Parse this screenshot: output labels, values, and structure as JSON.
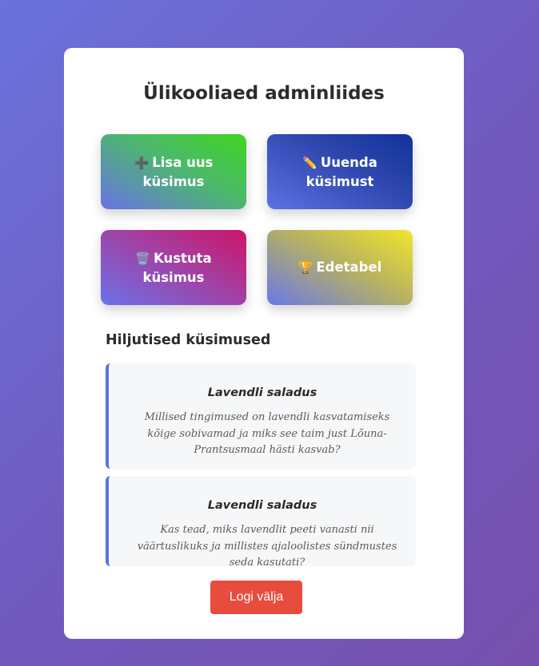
{
  "page": {
    "title": "Ülikooliaed adminliides"
  },
  "actions": {
    "add": {
      "icon": "➕",
      "icon_name": "plus-icon",
      "label": "Lisa uus küsimus"
    },
    "update": {
      "icon": "✏️",
      "icon_name": "pencil-icon",
      "label": "Uuenda küsimust"
    },
    "delete": {
      "icon": "🗑️",
      "icon_name": "wastebasket-icon",
      "label": "Kustuta küsimus"
    },
    "leaderboard": {
      "icon": "🏆",
      "icon_name": "trophy-icon",
      "label": "Edetabel"
    }
  },
  "recent": {
    "heading": "Hiljutised küsimused",
    "items": [
      {
        "title": "Lavendli saladus",
        "text": "Millised tingimused on lavendli kasvatamiseks kõige sobivamad ja miks see taim just Lõuna-Prantsusmaal hästi kasvab?"
      },
      {
        "title": "Lavendli saladus",
        "text": "Kas tead, miks lavendlit peeti vanasti nii väärtuslikuks ja millistes ajaloolistes sündmustes seda kasutati?"
      }
    ]
  },
  "logout": {
    "label": "Logi välja"
  },
  "colors": {
    "accent": "#5b72e0",
    "logout": "#e84c3d",
    "card_bg": "#ffffff",
    "question_bg": "#f6f7f9"
  }
}
